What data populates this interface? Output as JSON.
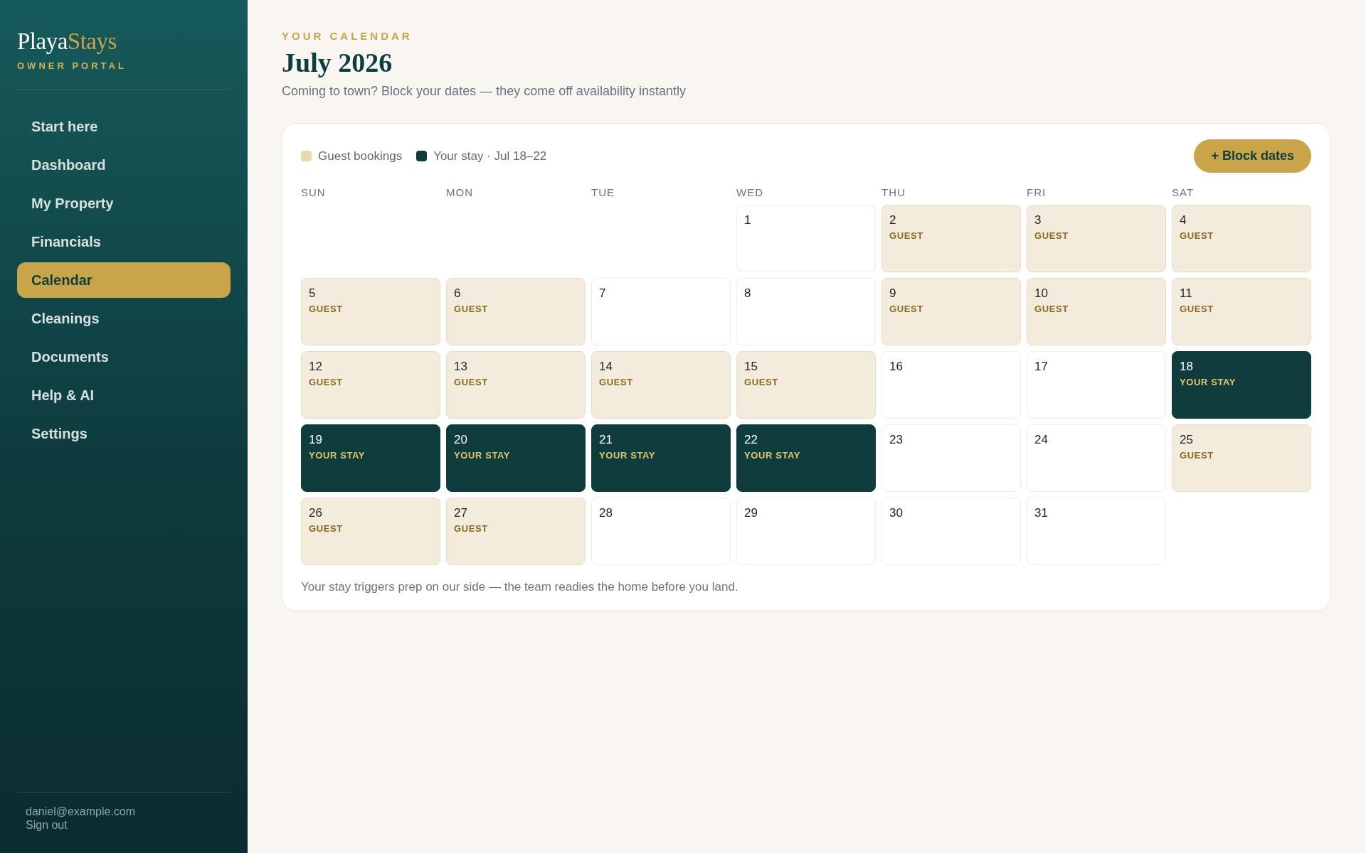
{
  "sidebar": {
    "brand": {
      "first": "Playa",
      "second": "Stays"
    },
    "tagline": "OWNER PORTAL",
    "nav": [
      {
        "label": "Start here",
        "selected": false
      },
      {
        "label": "Dashboard",
        "selected": false
      },
      {
        "label": "My Property",
        "selected": false
      },
      {
        "label": "Financials",
        "selected": false
      },
      {
        "label": "Calendar",
        "selected": true
      },
      {
        "label": "Cleanings",
        "selected": false
      },
      {
        "label": "Documents",
        "selected": false
      },
      {
        "label": "Help & AI",
        "selected": false
      },
      {
        "label": "Settings",
        "selected": false
      }
    ],
    "account": {
      "email": "daniel@example.com",
      "sign_out": "Sign out"
    }
  },
  "header": {
    "eyebrow": "YOUR CALENDAR",
    "title": "July 2026",
    "subtitle": "Coming to town? Block your dates — they come off availability instantly"
  },
  "calendar": {
    "legend": [
      {
        "label": "Guest bookings",
        "color": "#e8d9ae"
      },
      {
        "label": "Your stay · Jul 18–22",
        "color": "#0f3d3e"
      }
    ],
    "action": "+ Block dates",
    "weekdays": [
      "SUN",
      "MON",
      "TUE",
      "WED",
      "THU",
      "FRI",
      "SAT"
    ],
    "days": [
      {
        "kind": "blank"
      },
      {
        "kind": "blank"
      },
      {
        "kind": "blank"
      },
      {
        "day": "1",
        "kind": "free"
      },
      {
        "day": "2",
        "kind": "guest",
        "label": "GUEST"
      },
      {
        "day": "3",
        "kind": "guest",
        "label": "GUEST"
      },
      {
        "day": "4",
        "kind": "guest",
        "label": "GUEST"
      },
      {
        "day": "5",
        "kind": "guest",
        "label": "GUEST"
      },
      {
        "day": "6",
        "kind": "guest",
        "label": "GUEST"
      },
      {
        "day": "7",
        "kind": "free"
      },
      {
        "day": "8",
        "kind": "free"
      },
      {
        "day": "9",
        "kind": "guest",
        "label": "GUEST"
      },
      {
        "day": "10",
        "kind": "guest",
        "label": "GUEST"
      },
      {
        "day": "11",
        "kind": "guest",
        "label": "GUEST"
      },
      {
        "day": "12",
        "kind": "guest",
        "label": "GUEST"
      },
      {
        "day": "13",
        "kind": "guest",
        "label": "GUEST"
      },
      {
        "day": "14",
        "kind": "guest",
        "label": "GUEST"
      },
      {
        "day": "15",
        "kind": "guest",
        "label": "GUEST"
      },
      {
        "day": "16",
        "kind": "free"
      },
      {
        "day": "17",
        "kind": "free"
      },
      {
        "day": "18",
        "kind": "owner",
        "label": "YOUR STAY"
      },
      {
        "day": "19",
        "kind": "owner",
        "label": "YOUR STAY"
      },
      {
        "day": "20",
        "kind": "owner",
        "label": "YOUR STAY"
      },
      {
        "day": "21",
        "kind": "owner",
        "label": "YOUR STAY"
      },
      {
        "day": "22",
        "kind": "owner",
        "label": "YOUR STAY"
      },
      {
        "day": "23",
        "kind": "free"
      },
      {
        "day": "24",
        "kind": "free"
      },
      {
        "day": "25",
        "kind": "guest",
        "label": "GUEST"
      },
      {
        "day": "26",
        "kind": "guest",
        "label": "GUEST"
      },
      {
        "day": "27",
        "kind": "guest",
        "label": "GUEST"
      },
      {
        "day": "28",
        "kind": "free"
      },
      {
        "day": "29",
        "kind": "free"
      },
      {
        "day": "30",
        "kind": "free"
      },
      {
        "day": "31",
        "kind": "free"
      }
    ],
    "note": "Your stay triggers prep on our side — the team readies the home before you land."
  }
}
